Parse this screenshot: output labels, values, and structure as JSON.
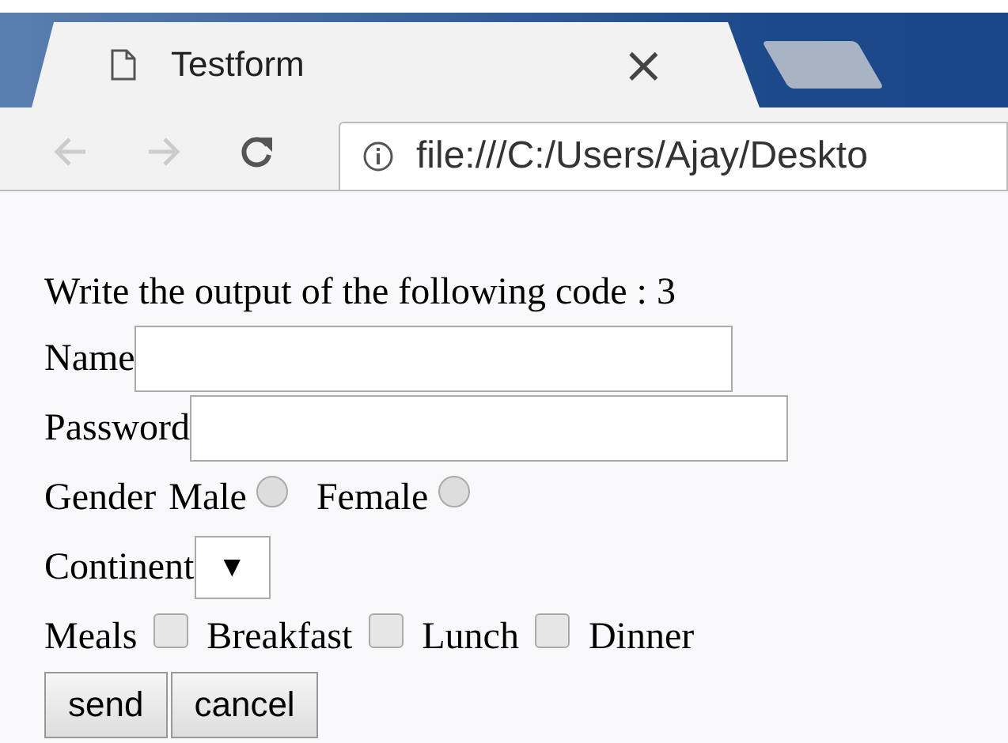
{
  "tab": {
    "title": "Testform",
    "close": "×"
  },
  "address_bar": {
    "url": "file:///C:/Users/Ajay/Deskto"
  },
  "content": {
    "heading": "Write the output of the following code : 3",
    "fields": [
      {
        "label": "Name"
      },
      {
        "label": "Password"
      }
    ],
    "gender": {
      "label": "Gender",
      "options": [
        {
          "label": "Male",
          "selected": false
        },
        {
          "label": "Female",
          "selected": false
        }
      ]
    },
    "continent": {
      "label": "Continent",
      "arrow": "▼"
    },
    "meals": {
      "label": "Meals",
      "options": [
        {
          "label": "Breakfast",
          "checked": false
        },
        {
          "label": "Lunch",
          "checked": false
        },
        {
          "label": "Dinner",
          "checked": false
        }
      ]
    },
    "buttons": [
      "send",
      "cancel"
    ]
  }
}
